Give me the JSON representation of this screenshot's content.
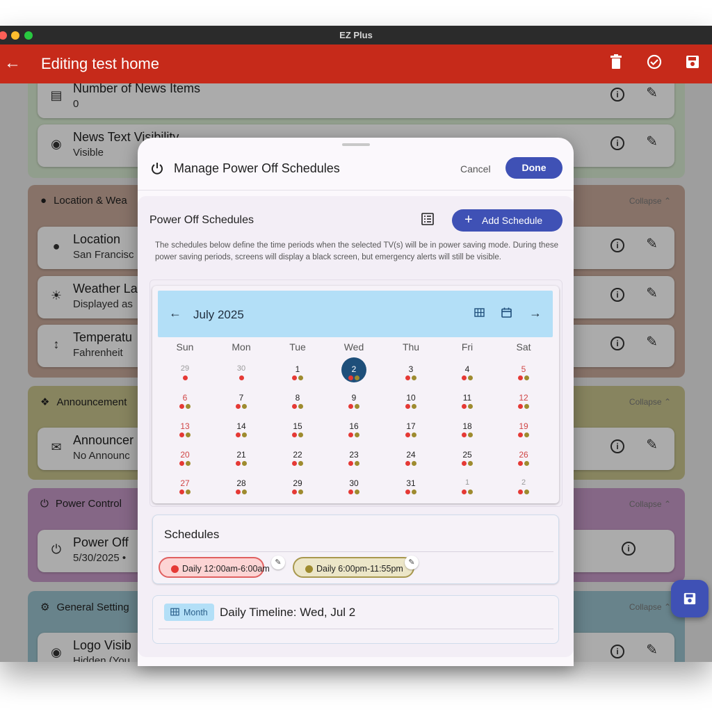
{
  "window": {
    "title": "EZ Plus"
  },
  "appbar": {
    "title": "Editing test home"
  },
  "sections": [
    {
      "header": "",
      "collapse": ""
    },
    {
      "header": "Location & Wea",
      "collapse": "Collapse"
    },
    {
      "header": "Announcement",
      "collapse": "Collapse"
    },
    {
      "header": "Power Control",
      "collapse": "Collapse"
    },
    {
      "header": "General Setting",
      "collapse": "Collapse"
    }
  ],
  "cards": [
    {
      "title": "Number of News Items",
      "subtitle": "0"
    },
    {
      "title": "News Text Visibility",
      "subtitle": "Visible"
    },
    {
      "title": "Location",
      "subtitle": "San Francisc"
    },
    {
      "title": "Weather La",
      "subtitle": "Displayed as"
    },
    {
      "title": "Temperatu",
      "subtitle": "Fahrenheit"
    },
    {
      "title": "Announcer",
      "subtitle": "No Announc"
    },
    {
      "title": "Power Off",
      "subtitle": "5/30/2025 •"
    },
    {
      "title": "Logo Visib",
      "subtitle": "Hidden (You"
    }
  ],
  "modal": {
    "title": "Manage Power Off Schedules",
    "cancel": "Cancel",
    "done": "Done",
    "section_title": "Power Off Schedules",
    "add_button": "Add Schedule",
    "description": "The schedules below define the time periods when the selected TV(s) will be in power saving mode. During these power saving periods, screens will display a black screen, but emergency alerts will still be visible.",
    "calendar": {
      "month_label": "July 2025",
      "weekdays": [
        "Sun",
        "Mon",
        "Tue",
        "Wed",
        "Thu",
        "Fri",
        "Sat"
      ],
      "days": [
        "29",
        "30",
        "1",
        "2",
        "3",
        "4",
        "5",
        "6",
        "7",
        "8",
        "9",
        "10",
        "11",
        "12",
        "13",
        "14",
        "15",
        "16",
        "17",
        "18",
        "19",
        "20",
        "21",
        "22",
        "23",
        "24",
        "25",
        "26",
        "27",
        "28",
        "29",
        "30",
        "31",
        "1",
        "2"
      ],
      "first_in_month_index": 2,
      "last_in_month_index": 32,
      "selected_index": 3,
      "dot_colors": {
        "night": "#e53935",
        "evening": "#9e8b2f"
      }
    },
    "schedules_title": "Schedules",
    "schedules": [
      {
        "label": "Daily 12:00am-6:00am",
        "color": "#e53935",
        "bg": "#fcd4d4",
        "border": "#e06060"
      },
      {
        "label": "Daily 6:00pm-11:55pm",
        "color": "#9e8b2f",
        "bg": "#ece6c8",
        "border": "#a8984e"
      }
    ],
    "timeline": {
      "badge": "Month",
      "title": "Daily Timeline: Wed, Jul 2"
    }
  },
  "colors": {
    "appbar": "#c62a1a",
    "primary": "#3f51b5",
    "calendar_header": "#b3dff7"
  }
}
